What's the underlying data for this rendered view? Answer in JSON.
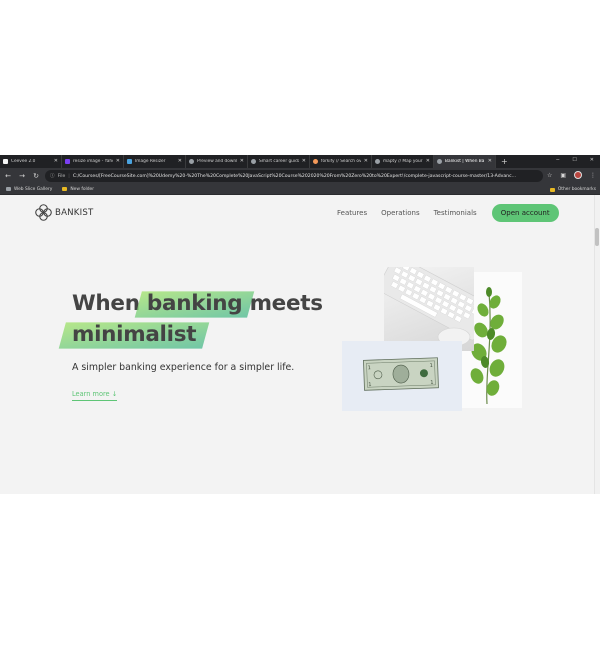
{
  "browser": {
    "tabs": [
      {
        "label": "Ceevee 2.0",
        "color": "#f5f5f5"
      },
      {
        "label": "resize image - Yahoo",
        "color": "#7b3ff2"
      },
      {
        "label": "Image Resizer",
        "color": "#4aa3df"
      },
      {
        "label": "Preview and download",
        "color": "#9aa0a6"
      },
      {
        "label": "Smart career guidance",
        "color": "#9aa0a6"
      },
      {
        "label": "forkify // Search over",
        "color": "#f59a5a"
      },
      {
        "label": "mapty // Map your",
        "color": "#9aa0a6"
      },
      {
        "label": "Bankist | When Ba",
        "color": "#9aa0a6",
        "active": true
      }
    ],
    "new_tab": "+",
    "address": {
      "scheme_label": "File",
      "url": "C:/Courses/[FreeCourseSite.com]%20Udemy%20-%20The%20Complete%20JavaScript%20Course%202020%20From%20Zero%20to%20Expert!/complete-javascript-course-master/13-Advanc..."
    },
    "bookmarks": [
      {
        "label": "Web Slice Gallery"
      },
      {
        "label": "New folder"
      }
    ],
    "other_bookmarks": "Other bookmarks"
  },
  "site": {
    "logo_text": "BANKIST",
    "nav": [
      "Features",
      "Operations",
      "Testimonials"
    ],
    "cta": "Open account",
    "hero": {
      "title_1": "When",
      "title_hl_1": "banking",
      "title_2": "meets",
      "title_hl_2": "minimalist",
      "subtitle": "A simpler banking experience for a simpler life.",
      "learn_more": "Learn more ↓"
    },
    "accent": "#5ec576"
  }
}
